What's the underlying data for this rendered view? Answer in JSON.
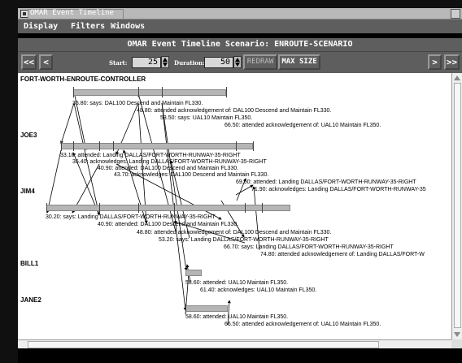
{
  "window": {
    "title": "OMAR Event Timeline",
    "menu": [
      "Display",
      "Filters",
      "Windows"
    ],
    "scenario_title": "OMAR Event Timeline Scenario: ENROUTE-SCENARIO"
  },
  "toolbar": {
    "first_label": "<<",
    "prev_label": "<",
    "start_label": "Start:",
    "start_value": "25",
    "duration_label": "Duration:",
    "duration_value": "50",
    "redraw_label": "REDRAW",
    "max_size_label": "MAX SIZE",
    "next_label": ">",
    "last_label": ">>"
  },
  "timeline": {
    "rows": [
      {
        "name": "FORT-WORTH-ENROUTE-CONTROLLER",
        "events": [
          "35.80: says: DAL100 Descend and Maintain FL330.",
          "48.80: attended acknowledgement of: DAL100 Descend and Maintain FL330.",
          "53.50: says: UAL10 Maintain FL350.",
          "66.50: attended acknowledgement of: UAL10 Maintain FL350."
        ]
      },
      {
        "name": "JOE3",
        "events": [
          "33.10: attended: Landing DALLAS/FORT-WORTH-RUNWAY-35-RIGHT",
          "35.40: acknowledges: Landing DALLAS/FORT-WORTH-RUNWAY-35-RIGHT",
          "40.90: attended: DAL100 Descend and Maintain FL330.",
          "43.70: acknowledges: DAL100 Descend and Maintain FL330.",
          "69.60: attended: Landing DALLAS/FORT-WORTH-RUNWAY-35-RIGHT",
          "71.90: acknowledges: Landing DALLAS/FORT-WORTH-RUNWAY-35"
        ]
      },
      {
        "name": "JIM4",
        "events": [
          "30.20: says: Landing DALLAS/FORT-WORTH-RUNWAY-35-RIGHT",
          "40.90: attended: DAL100 Descend and Maintain FL330.",
          "48.80: attended acknowledgement of: DAL100 Descend and Maintain FL330.",
          "53.20: says: Landing DALLAS/FORT-WORTH-RUNWAY-35-RIGHT",
          "66.70: says: Landing DALLAS/FORT-WORTH-RUNWAY-35-RIGHT",
          "74.80: attended acknowledgement of: Landing DALLAS/FORT-W"
        ]
      },
      {
        "name": "BILL1",
        "events": [
          "58.60: attended: UAL10 Maintain FL350.",
          "61.40: acknowledges: UAL10 Maintain FL350."
        ]
      },
      {
        "name": "JANE2",
        "events": [
          "58.60: attended: UAL10 Maintain FL350.",
          "66.50: attended acknowledgement of: UAL10 Maintain FL350."
        ]
      }
    ]
  }
}
